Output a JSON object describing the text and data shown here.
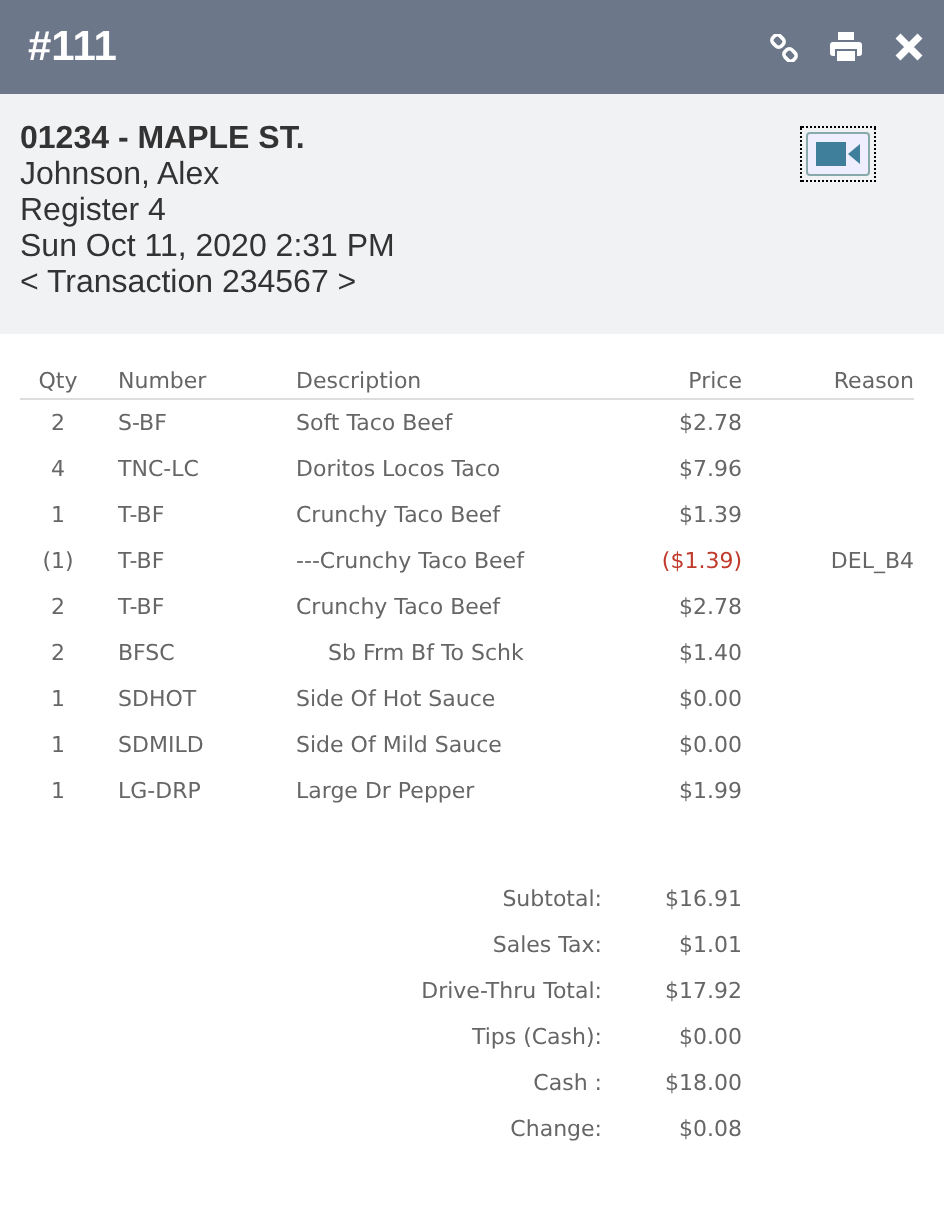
{
  "header": {
    "title": "#111"
  },
  "info": {
    "store": "01234 - MAPLE ST.",
    "employee": "Johnson, Alex",
    "register": "Register 4",
    "datetime": "Sun Oct 11, 2020 2:31 PM",
    "transaction": "< Transaction 234567 >"
  },
  "table": {
    "columns": [
      "Qty",
      "Number",
      "Description",
      "Price",
      "Reason"
    ],
    "rows": [
      {
        "kind": "item",
        "qty": "2",
        "number": "S-BF",
        "description": "Soft Taco Beef",
        "price": "$2.78"
      },
      {
        "kind": "item",
        "qty": "4",
        "number": "TNC-LC",
        "description": "Doritos Locos Taco",
        "price": "$7.96"
      },
      {
        "kind": "item",
        "qty": "1",
        "number": "T-BF",
        "description": "Crunchy Taco Beef",
        "price": "$1.39"
      },
      {
        "kind": "void",
        "qty": "(1)",
        "number": "T-BF",
        "description": "---Crunchy Taco Beef",
        "price": "($1.39)",
        "reason": "DEL_B4"
      },
      {
        "kind": "item",
        "qty": "2",
        "number": "T-BF",
        "description": "Crunchy Taco Beef",
        "price": "$2.78"
      },
      {
        "kind": "modifier",
        "qty": "2",
        "number": "BFSC",
        "description": "Sb Frm Bf To Schk",
        "price": "$1.40"
      },
      {
        "kind": "item",
        "qty": "1",
        "number": "SDHOT",
        "description": "Side Of Hot Sauce",
        "price": "$0.00"
      },
      {
        "kind": "item",
        "qty": "1",
        "number": "SDMILD",
        "description": "Side Of Mild Sauce",
        "price": "$0.00"
      },
      {
        "kind": "item",
        "qty": "1",
        "number": "LG-DRP",
        "description": "Large Dr Pepper",
        "price": "$1.99"
      }
    ]
  },
  "totals": [
    {
      "label": "Subtotal:",
      "value": "$16.91"
    },
    {
      "label": "Sales Tax:",
      "value": "$1.01"
    },
    {
      "label": "Drive-Thru Total:",
      "value": "$17.92"
    },
    {
      "label": "Tips (Cash):",
      "value": "$0.00"
    },
    {
      "label": "Cash :",
      "value": "$18.00"
    },
    {
      "label": "Change:",
      "value": "$0.08"
    }
  ]
}
